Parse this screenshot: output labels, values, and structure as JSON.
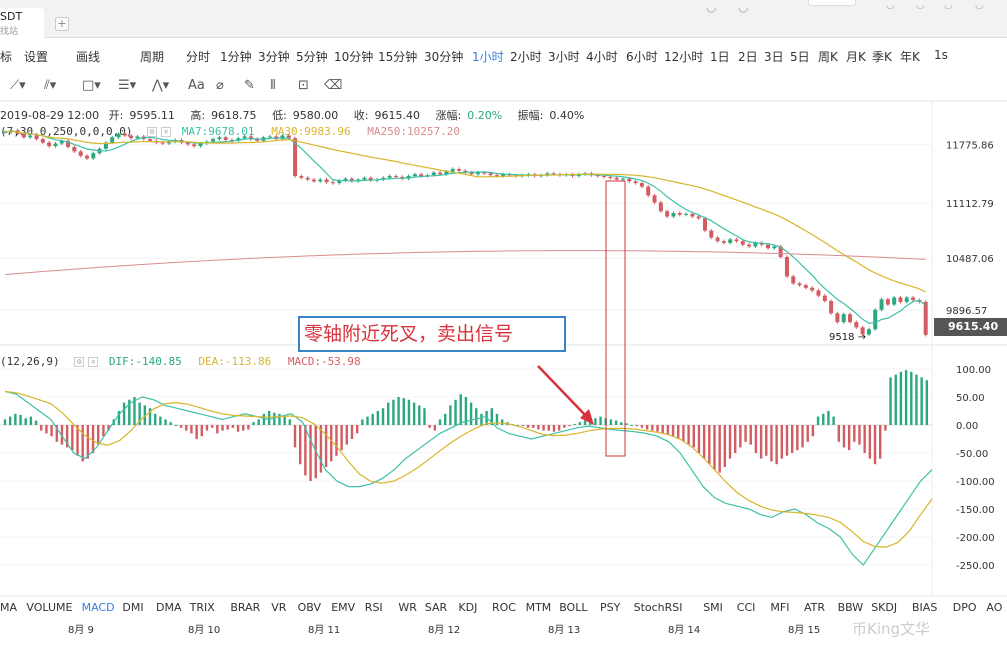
{
  "tab": {
    "title": "SDT",
    "subtitle": "找站"
  },
  "toolbar": {
    "items": [
      "标",
      "设置",
      "画线",
      "周期",
      "分时",
      "1分钟",
      "3分钟",
      "5分钟",
      "10分钟",
      "15分钟",
      "30分钟",
      "1小时",
      "2小时",
      "3小时",
      "4小时",
      "6小时",
      "12小时",
      "1日",
      "2日",
      "3日",
      "5日",
      "周K",
      "月K",
      "季K",
      "年K",
      "1s"
    ],
    "active": "1小时"
  },
  "ohlc": {
    "date": "2019-08-29 12:00",
    "open_label": "开:",
    "open": "9595.11",
    "high_label": "高:",
    "high": "9618.75",
    "low_label": "低:",
    "low": "9580.00",
    "close_label": "收:",
    "close": "9615.40",
    "change_label": "涨幅:",
    "change": "0.20%",
    "amp_label": "振幅:",
    "amp": "0.40%"
  },
  "ma_legend": {
    "params": "(7,30,0,250,0,0,0,0)",
    "ma7": "MA7:9678.01",
    "ma30": "MA30:9983.96",
    "ma250": "MA250:10257.20"
  },
  "macd_legend": {
    "params": "(12,26,9)",
    "dif": "DIF:-140.85",
    "dea": "DEA:-113.86",
    "macd": "MACD:-53.98"
  },
  "annotation": "零轴附近死叉，卖出信号",
  "current_price": "9615.40",
  "low_marker": "9518 →",
  "indicators": [
    "MA",
    "VOLUME",
    "MACD",
    "DMI",
    "DMA",
    "TRIX",
    "BRAR",
    "VR",
    "OBV",
    "EMV",
    "RSI",
    "WR",
    "SAR",
    "KDJ",
    "ROC",
    "MTM",
    "BOLL",
    "PSY",
    "StochRSI",
    "SMI",
    "CCI",
    "MFI",
    "ATR",
    "BBW",
    "SKDJ",
    "BIAS",
    "DPO",
    "AO"
  ],
  "active_indicator": "MACD",
  "watermark": "币King文华",
  "colors": {
    "up": "#2aa87f",
    "down": "#d25c61",
    "ma7": "#3cc0a8",
    "ma30": "#d8b52a",
    "ma250": "#d88d8d",
    "accent": "#3b7be0"
  },
  "chart_data": [
    {
      "type": "candlestick",
      "x_ticks": [
        "8月 9",
        "8月 10",
        "8月 11",
        "8月 12",
        "8月 13",
        "8月 14",
        "8月 15"
      ],
      "y_ticks": [
        11775.86,
        11112.79,
        10487.06,
        9896.57
      ],
      "ylim": [
        9500,
        12000
      ],
      "close": [
        11920,
        11940,
        11900,
        11860,
        11880,
        11840,
        11800,
        11760,
        11790,
        11820,
        11750,
        11700,
        11650,
        11620,
        11680,
        11730,
        11800,
        11860,
        11900,
        11880,
        11850,
        11870,
        11840,
        11820,
        11800,
        11790,
        11810,
        11830,
        11800,
        11780,
        11760,
        11790,
        11810,
        11840,
        11860,
        11830,
        11820,
        11850,
        11870,
        11840,
        11820,
        11860,
        11870,
        11840,
        11880,
        11850,
        11420,
        11400,
        11380,
        11360,
        11380,
        11350,
        11340,
        11370,
        11390,
        11360,
        11380,
        11400,
        11370,
        11380,
        11400,
        11420,
        11410,
        11390,
        11420,
        11440,
        11420,
        11430,
        11460,
        11440,
        11470,
        11500,
        11480,
        11460,
        11440,
        11460,
        11450,
        11430,
        11420,
        11440,
        11430,
        11420,
        11430,
        11440,
        11420,
        11430,
        11450,
        11440,
        11430,
        11440,
        11420,
        11440,
        11450,
        11430,
        11420,
        11410,
        11400,
        11380,
        11390,
        11360,
        11340,
        11300,
        11200,
        11120,
        11020,
        10960,
        11000,
        10980,
        10990,
        10960,
        10940,
        10800,
        10720,
        10680,
        10660,
        10700,
        10680,
        10640,
        10620,
        10660,
        10640,
        10600,
        10620,
        10500,
        10280,
        10200,
        10180,
        10150,
        10120,
        10060,
        10000,
        9860,
        9760,
        9850,
        9760,
        9700,
        9620,
        9680,
        9900,
        10020,
        9960,
        10040,
        9990,
        10040,
        10010,
        9990,
        9615
      ]
    },
    {
      "type": "macd",
      "y_ticks": [
        100.0,
        50.0,
        0.0,
        -50.0,
        -100.0,
        -150.0,
        -200.0,
        -250.0
      ],
      "ylim": [
        -260,
        110
      ],
      "hist": [
        10,
        15,
        20,
        18,
        12,
        15,
        8,
        -10,
        -15,
        -20,
        -30,
        -35,
        -40,
        -45,
        -55,
        -65,
        -60,
        -50,
        -35,
        -20,
        -10,
        10,
        25,
        40,
        45,
        50,
        40,
        35,
        30,
        20,
        15,
        10,
        5,
        0,
        -5,
        -10,
        -15,
        -25,
        -20,
        -10,
        -5,
        -15,
        -10,
        -8,
        -5,
        -12,
        -10,
        -8,
        5,
        10,
        20,
        25,
        22,
        20,
        15,
        10,
        -40,
        -70,
        -90,
        -100,
        -95,
        -85,
        -75,
        -65,
        -55,
        -45,
        -35,
        -25,
        -15,
        10,
        15,
        20,
        25,
        30,
        40,
        45,
        50,
        48,
        45,
        40,
        35,
        30,
        -5,
        -10,
        10,
        20,
        35,
        45,
        55,
        50,
        40,
        30,
        20,
        25,
        30,
        20,
        10,
        5,
        2,
        0,
        -2,
        -5,
        -5,
        -8,
        -10,
        -10,
        -12,
        -10,
        -5,
        -2,
        2,
        5,
        8,
        10,
        12,
        15,
        12,
        10,
        8,
        5,
        3,
        0,
        -2,
        -5,
        -8,
        -10,
        -12,
        -15,
        -18,
        -20,
        -25,
        -30,
        -35,
        -40,
        -50,
        -60,
        -70,
        -80,
        -85,
        -75,
        -60,
        -50,
        -40,
        -30,
        -35,
        -50,
        -60,
        -55,
        -65,
        -70,
        -60,
        -55,
        -50,
        -45,
        -40,
        -30,
        -20,
        15,
        20,
        25,
        15,
        -30,
        -40,
        -45,
        -30,
        -35,
        -50,
        -60,
        -70,
        -60,
        -10,
        85,
        90,
        95,
        98,
        95,
        90,
        85,
        80
      ],
      "dif": [
        60,
        55,
        40,
        25,
        10,
        -20,
        -50,
        -60,
        -40,
        -10,
        20,
        40,
        50,
        45,
        35,
        30,
        25,
        20,
        15,
        10,
        15,
        20,
        15,
        10,
        15,
        20,
        5,
        -40,
        -80,
        -100,
        -110,
        -110,
        -105,
        -95,
        -80,
        -60,
        -45,
        -30,
        -15,
        -5,
        5,
        10,
        15,
        -5,
        -15,
        -20,
        -25,
        -20,
        -15,
        -10,
        -5,
        -2,
        -5,
        -8,
        -10,
        -12,
        -15,
        -20,
        -30,
        -50,
        -80,
        -110,
        -130,
        -140,
        -145,
        -150,
        -160,
        -165,
        -155,
        -150,
        -160,
        -175,
        -185,
        -200,
        -230,
        -250,
        -220,
        -190,
        -160,
        -130,
        -100,
        -80
      ]
    }
  ]
}
